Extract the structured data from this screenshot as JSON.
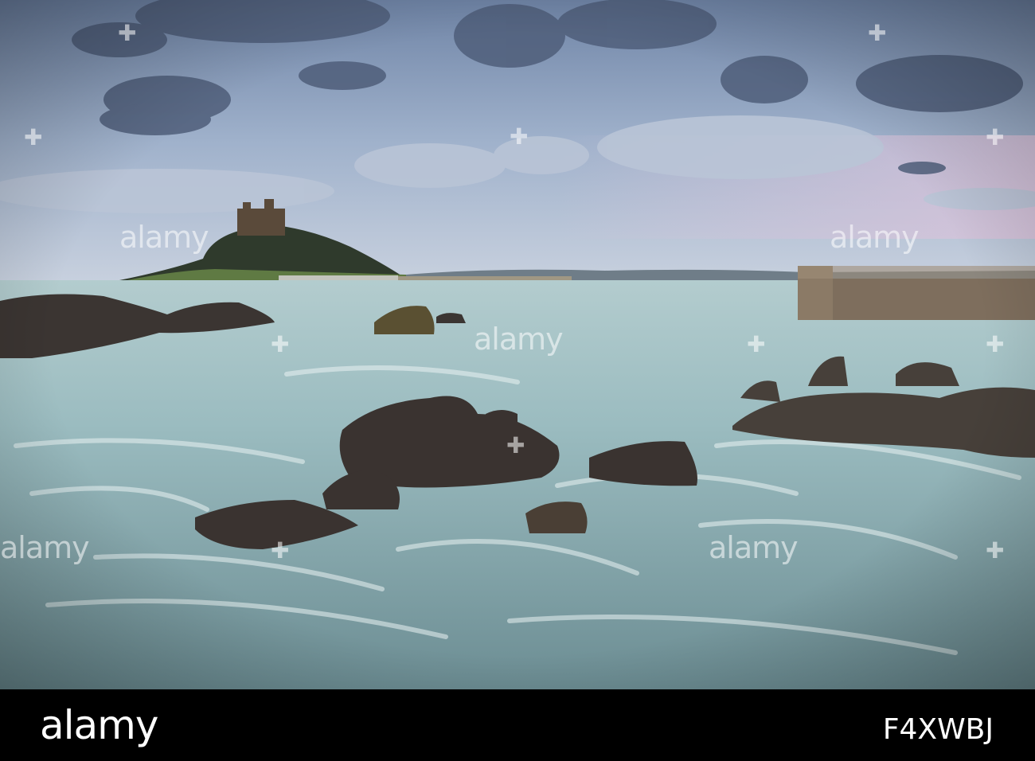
{
  "image": {
    "subject": "seascape-rocks-castle-island",
    "palette": {
      "sky_top": "#7a8fae",
      "sky_mid": "#a7b8cf",
      "sky_pink": "#d9c3d9",
      "sea": "#9cb9bd",
      "sea_dark": "#6f8f95",
      "rocks": "#3a3330",
      "foam": "#e4eef0"
    }
  },
  "watermark": {
    "brand": "alamy"
  },
  "footer": {
    "logo_text": "alamy",
    "image_id": "F4XWBJ"
  }
}
